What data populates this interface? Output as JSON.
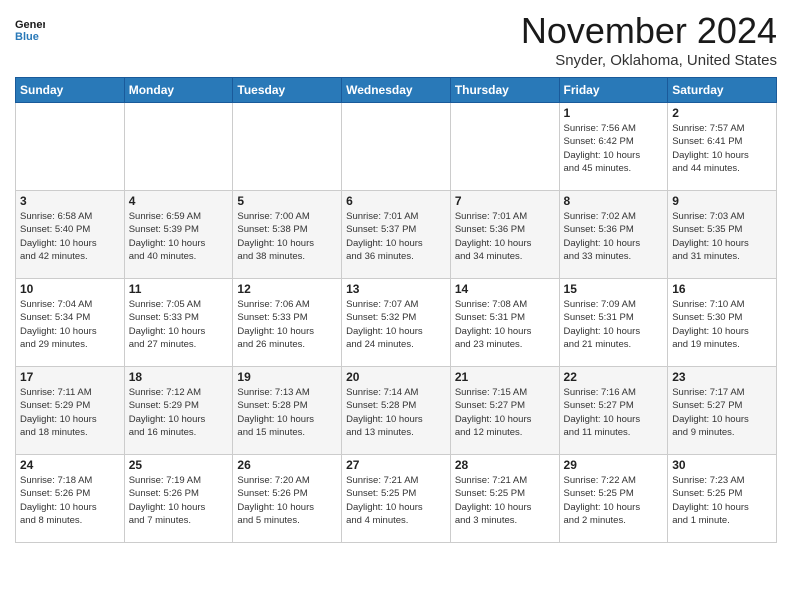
{
  "header": {
    "logo_line1": "General",
    "logo_line2": "Blue",
    "month": "November 2024",
    "location": "Snyder, Oklahoma, United States"
  },
  "weekdays": [
    "Sunday",
    "Monday",
    "Tuesday",
    "Wednesday",
    "Thursday",
    "Friday",
    "Saturday"
  ],
  "weeks": [
    [
      {
        "day": "",
        "info": ""
      },
      {
        "day": "",
        "info": ""
      },
      {
        "day": "",
        "info": ""
      },
      {
        "day": "",
        "info": ""
      },
      {
        "day": "",
        "info": ""
      },
      {
        "day": "1",
        "info": "Sunrise: 7:56 AM\nSunset: 6:42 PM\nDaylight: 10 hours\nand 45 minutes."
      },
      {
        "day": "2",
        "info": "Sunrise: 7:57 AM\nSunset: 6:41 PM\nDaylight: 10 hours\nand 44 minutes."
      }
    ],
    [
      {
        "day": "3",
        "info": "Sunrise: 6:58 AM\nSunset: 5:40 PM\nDaylight: 10 hours\nand 42 minutes."
      },
      {
        "day": "4",
        "info": "Sunrise: 6:59 AM\nSunset: 5:39 PM\nDaylight: 10 hours\nand 40 minutes."
      },
      {
        "day": "5",
        "info": "Sunrise: 7:00 AM\nSunset: 5:38 PM\nDaylight: 10 hours\nand 38 minutes."
      },
      {
        "day": "6",
        "info": "Sunrise: 7:01 AM\nSunset: 5:37 PM\nDaylight: 10 hours\nand 36 minutes."
      },
      {
        "day": "7",
        "info": "Sunrise: 7:01 AM\nSunset: 5:36 PM\nDaylight: 10 hours\nand 34 minutes."
      },
      {
        "day": "8",
        "info": "Sunrise: 7:02 AM\nSunset: 5:36 PM\nDaylight: 10 hours\nand 33 minutes."
      },
      {
        "day": "9",
        "info": "Sunrise: 7:03 AM\nSunset: 5:35 PM\nDaylight: 10 hours\nand 31 minutes."
      }
    ],
    [
      {
        "day": "10",
        "info": "Sunrise: 7:04 AM\nSunset: 5:34 PM\nDaylight: 10 hours\nand 29 minutes."
      },
      {
        "day": "11",
        "info": "Sunrise: 7:05 AM\nSunset: 5:33 PM\nDaylight: 10 hours\nand 27 minutes."
      },
      {
        "day": "12",
        "info": "Sunrise: 7:06 AM\nSunset: 5:33 PM\nDaylight: 10 hours\nand 26 minutes."
      },
      {
        "day": "13",
        "info": "Sunrise: 7:07 AM\nSunset: 5:32 PM\nDaylight: 10 hours\nand 24 minutes."
      },
      {
        "day": "14",
        "info": "Sunrise: 7:08 AM\nSunset: 5:31 PM\nDaylight: 10 hours\nand 23 minutes."
      },
      {
        "day": "15",
        "info": "Sunrise: 7:09 AM\nSunset: 5:31 PM\nDaylight: 10 hours\nand 21 minutes."
      },
      {
        "day": "16",
        "info": "Sunrise: 7:10 AM\nSunset: 5:30 PM\nDaylight: 10 hours\nand 19 minutes."
      }
    ],
    [
      {
        "day": "17",
        "info": "Sunrise: 7:11 AM\nSunset: 5:29 PM\nDaylight: 10 hours\nand 18 minutes."
      },
      {
        "day": "18",
        "info": "Sunrise: 7:12 AM\nSunset: 5:29 PM\nDaylight: 10 hours\nand 16 minutes."
      },
      {
        "day": "19",
        "info": "Sunrise: 7:13 AM\nSunset: 5:28 PM\nDaylight: 10 hours\nand 15 minutes."
      },
      {
        "day": "20",
        "info": "Sunrise: 7:14 AM\nSunset: 5:28 PM\nDaylight: 10 hours\nand 13 minutes."
      },
      {
        "day": "21",
        "info": "Sunrise: 7:15 AM\nSunset: 5:27 PM\nDaylight: 10 hours\nand 12 minutes."
      },
      {
        "day": "22",
        "info": "Sunrise: 7:16 AM\nSunset: 5:27 PM\nDaylight: 10 hours\nand 11 minutes."
      },
      {
        "day": "23",
        "info": "Sunrise: 7:17 AM\nSunset: 5:27 PM\nDaylight: 10 hours\nand 9 minutes."
      }
    ],
    [
      {
        "day": "24",
        "info": "Sunrise: 7:18 AM\nSunset: 5:26 PM\nDaylight: 10 hours\nand 8 minutes."
      },
      {
        "day": "25",
        "info": "Sunrise: 7:19 AM\nSunset: 5:26 PM\nDaylight: 10 hours\nand 7 minutes."
      },
      {
        "day": "26",
        "info": "Sunrise: 7:20 AM\nSunset: 5:26 PM\nDaylight: 10 hours\nand 5 minutes."
      },
      {
        "day": "27",
        "info": "Sunrise: 7:21 AM\nSunset: 5:25 PM\nDaylight: 10 hours\nand 4 minutes."
      },
      {
        "day": "28",
        "info": "Sunrise: 7:21 AM\nSunset: 5:25 PM\nDaylight: 10 hours\nand 3 minutes."
      },
      {
        "day": "29",
        "info": "Sunrise: 7:22 AM\nSunset: 5:25 PM\nDaylight: 10 hours\nand 2 minutes."
      },
      {
        "day": "30",
        "info": "Sunrise: 7:23 AM\nSunset: 5:25 PM\nDaylight: 10 hours\nand 1 minute."
      }
    ]
  ]
}
